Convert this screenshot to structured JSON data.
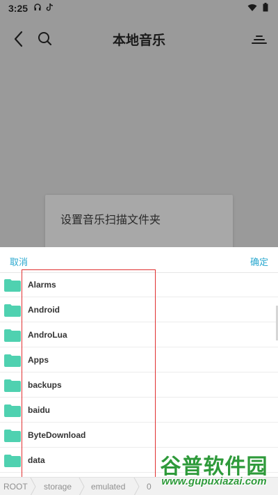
{
  "status_bar": {
    "time": "3:25",
    "headphones_icon": "headphones-icon",
    "tiktok_icon": "tiktok-icon",
    "wifi_icon": "wifi-icon",
    "battery_icon": "battery-icon"
  },
  "app_bar": {
    "title": "本地音乐",
    "back_icon": "chevron-left-icon",
    "search_icon": "search-icon",
    "menu_icon": "sort-menu-icon"
  },
  "background_dialog": {
    "title": "设置音乐扫描文件夹"
  },
  "folder_picker": {
    "cancel_label": "取消",
    "confirm_label": "确定",
    "folder_icon_color": "#4fd1b0",
    "folders": [
      {
        "name": "Alarms"
      },
      {
        "name": "Android"
      },
      {
        "name": "AndroLua"
      },
      {
        "name": "Apps"
      },
      {
        "name": "backups"
      },
      {
        "name": "baidu"
      },
      {
        "name": "ByteDownload"
      },
      {
        "name": "data"
      }
    ],
    "path": [
      "ROOT",
      "storage",
      "emulated",
      "0"
    ]
  },
  "watermark": {
    "title": "谷普软件园",
    "url": "www.gupuxiazai.com"
  },
  "colors": {
    "accent": "#2aa8cf",
    "overlay": "#9a9a9a",
    "highlight": "#e03030",
    "watermark": "#2e9a3a"
  }
}
